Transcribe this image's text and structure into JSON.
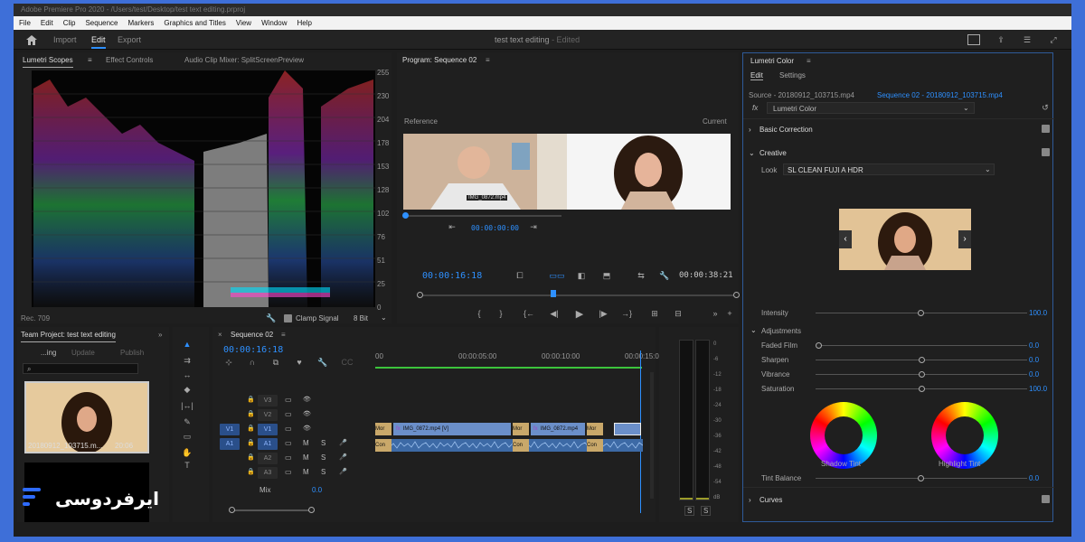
{
  "window": {
    "title": "Adobe Premiere Pro 2020 - /Users/test/Desktop/test text editing.prproj"
  },
  "menu": [
    "File",
    "Edit",
    "Clip",
    "Sequence",
    "Markers",
    "Graphics and Titles",
    "View",
    "Window",
    "Help"
  ],
  "workspaces": {
    "home": "home-icon",
    "import": "Import",
    "edit": "Edit",
    "export": "Export",
    "project_title": "test text editing",
    "edited": "- Edited"
  },
  "scopes": {
    "tabs": [
      "Lumetri Scopes",
      "Effect Controls",
      "Audio Clip Mixer: SplitScreenPreview"
    ],
    "scale": [
      "255",
      "230",
      "204",
      "178",
      "153",
      "128",
      "102",
      "76",
      "51",
      "25",
      "0"
    ],
    "rec": "Rec. 709",
    "clamp": "Clamp Signal",
    "bit": "8 Bit"
  },
  "program": {
    "title": "Program: Sequence 02",
    "reference": "Reference",
    "current": "Current",
    "ref_timecode": "00:00:00:00",
    "clip_label": "IMG_0872.mp4",
    "timecode": "00:00:16:18",
    "duration": "00:00:38:21"
  },
  "project": {
    "title": "Team Project: test text editing",
    "buttons": [
      "...ing",
      "Update",
      "Publish"
    ],
    "clip_name": "20180912_103715.m...",
    "clip_duration": "20:06"
  },
  "sequence": {
    "tab": "Sequence 02",
    "timecode": "00:00:16:18",
    "ruler": [
      "00",
      "00:00:05:00",
      "00:00:10:00",
      "00:00:15:00"
    ],
    "tracks": [
      {
        "name": "V3"
      },
      {
        "name": "V2"
      },
      {
        "name": "V1",
        "src": "V1"
      },
      {
        "name": "A1",
        "src": "A1"
      },
      {
        "name": "A2"
      },
      {
        "name": "A3"
      }
    ],
    "mix": "Mix",
    "mix_val": "0.0",
    "clip_v": "IMG_0872.mp4 [V]",
    "clip_v2": "IMG_0872.mp4",
    "mor": "Mor",
    "con": "Con",
    "fx": "fx"
  },
  "meter": {
    "scale": [
      "0",
      "-6",
      "-12",
      "-18",
      "-24",
      "-30",
      "-36",
      "-42",
      "-48",
      "-54",
      "dB"
    ],
    "solo": [
      "S",
      "S"
    ]
  },
  "lumetri": {
    "title": "Lumetri Color",
    "tabs": [
      "Edit",
      "Settings"
    ],
    "source": "Source - 20180912_103715.mp4",
    "sequence_src": "Sequence 02 - 20180912_103715.mp4",
    "effect": "Lumetri Color",
    "basic": "Basic Correction",
    "creative": "Creative",
    "look_label": "Look",
    "look_value": "SL CLEAN FUJI A HDR",
    "intensity": {
      "label": "Intensity",
      "value": "100.0"
    },
    "adjustments": "Adjustments",
    "sliders": [
      {
        "label": "Faded Film",
        "value": "0.0",
        "pos": 0
      },
      {
        "label": "Sharpen",
        "value": "0.0",
        "pos": 0.5
      },
      {
        "label": "Vibrance",
        "value": "0.0",
        "pos": 0.5
      },
      {
        "label": "Saturation",
        "value": "100.0",
        "pos": 0.5
      }
    ],
    "shadow": "Shadow Tint",
    "highlight": "Highlight Tint",
    "tint_balance": {
      "label": "Tint Balance",
      "value": "0.0"
    },
    "curves": "Curves"
  },
  "brand": "ایرفردوسی",
  "colors": {
    "accent": "#2e90ff",
    "background": "#3e6fd8"
  }
}
